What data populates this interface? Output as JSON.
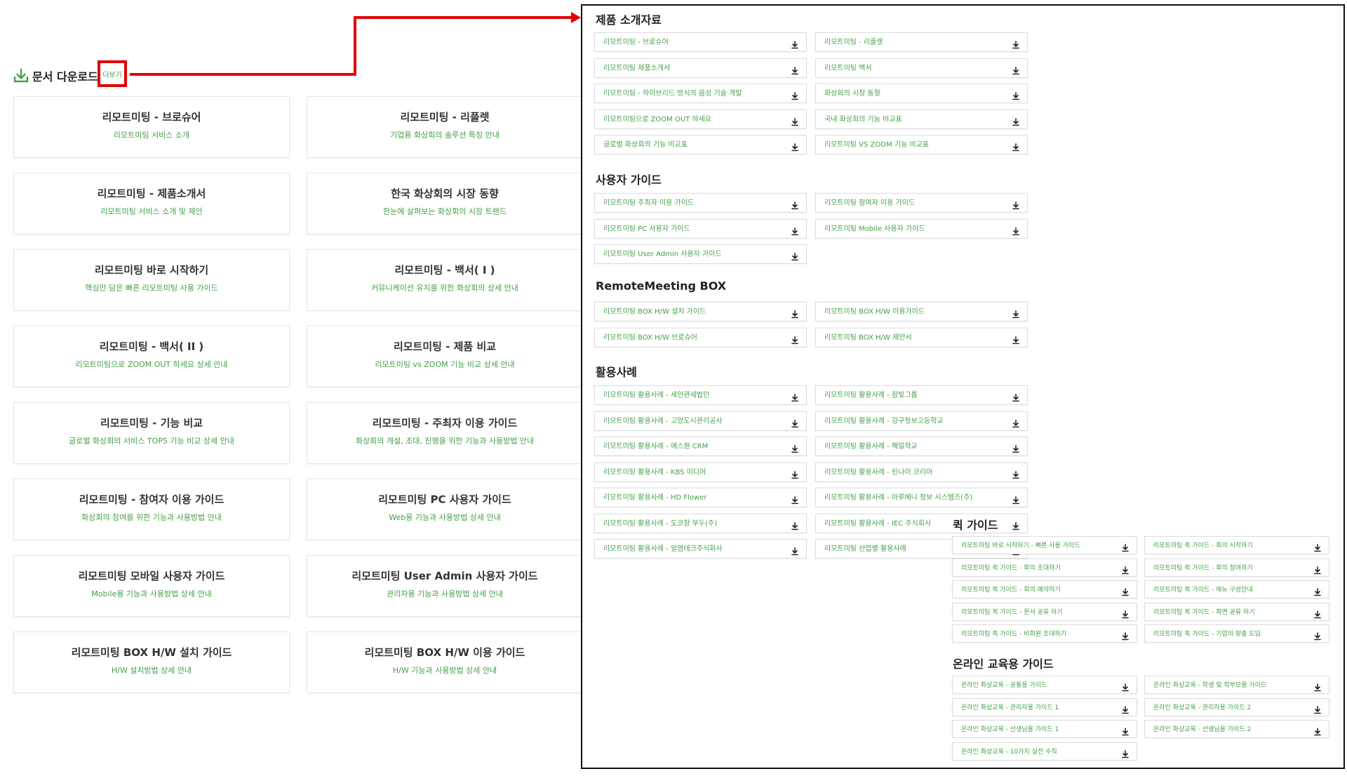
{
  "left": {
    "header_title": "문서 다운로드",
    "more_label": "더보기",
    "cards": [
      {
        "title": "리모트미팅 - 브로슈어",
        "sub": "리모트미팅 서비스 소개"
      },
      {
        "title": "리모트미팅 - 리플렛",
        "sub": "기업용 화상회의 솔루션 특징 안내"
      },
      {
        "title": "리모트미팅 - 제품소개서",
        "sub": "리모트미팅 서비스 소개 및 제안"
      },
      {
        "title": "한국 화상회의 시장 동향",
        "sub": "한눈에 살펴보는 화상회의 시장 트렌드"
      },
      {
        "title": "리모트미팅 바로 시작하기",
        "sub": "핵심만 담은 빠른 리모트미팅 사용 가이드"
      },
      {
        "title": "리모트미팅 - 백서( I )",
        "sub": "커뮤니케이션 유지를 위한 화상회의 상세 안내"
      },
      {
        "title": "리모트미팅 - 백서( II )",
        "sub": "리모트미팅으로 ZOOM OUT 하세요 상세 안내"
      },
      {
        "title": "리모트미팅 - 제품 비교",
        "sub": "리모트미팅 vs ZOOM 기능 비교 상세 안내"
      },
      {
        "title": "리모트미팅 - 기능 비교",
        "sub": "글로벌 화상회의 서비스 TOP5 기능 비교 상세 안내"
      },
      {
        "title": "리모트미팅 - 주최자 이용 가이드",
        "sub": "화상회의 개설, 초대, 진행을 위한 기능과 사용방법 안내"
      },
      {
        "title": "리모트미팅 - 참여자 이용 가이드",
        "sub": "화상회의 참여를 위한 기능과 사용방법 안내"
      },
      {
        "title": "리모트미팅 PC 사용자 가이드",
        "sub": "Web용 기능과 사용방법 상세 안내"
      },
      {
        "title": "리모트미팅 모바일 사용자 가이드",
        "sub": "Mobile용 기능과 사용방법 상세 안내"
      },
      {
        "title": "리모트미팅 User Admin 사용자 가이드",
        "sub": "관리자용 기능과 사용방법 상세 안내"
      },
      {
        "title": "리모트미팅 BOX H/W 설치 가이드",
        "sub": "H/W 설치방법 상세 안내"
      },
      {
        "title": "리모트미팅 BOX H/W 이용 가이드",
        "sub": "H/W 기능과 사용방법 상세 안내"
      }
    ]
  },
  "panel": {
    "sections": {
      "product": {
        "title": "제품 소개자료",
        "items": [
          "리모트미팅 - 브로슈어",
          "리모트미팅 - 리플렛",
          "리모트미팅 제품소개서",
          "리모트미팅 백서",
          "리모트미팅 - 하이브리드 방식의 음성 기술 개발",
          "화상회의 시장 동향",
          "리모트미팅으로 ZOOM OUT 하세요",
          "국내 화상회의 기능 비교표",
          "글로벌 화상회의 기능 비교표",
          "리모트미팅 VS ZOOM 기능 비교표"
        ]
      },
      "user_guide": {
        "title": "사용자 가이드",
        "items": [
          "리모트미팅 주최자 이용 가이드",
          "리모트미팅 참여자 이용 가이드",
          "리모트미팅 PC 사용자 가이드",
          "리모트미팅 Mobile 사용자 가이드",
          "리모트미팅 User Admin 사용자 가이드"
        ]
      },
      "box": {
        "title": "RemoteMeeting BOX",
        "items": [
          "리모트미팅 BOX H/W 설치 가이드",
          "리모트미팅 BOX H/W 이용가이드",
          "리모트미팅 BOX H/W 브로슈어",
          "리모트미팅 BOX H/W 제안서"
        ]
      },
      "cases": {
        "title": "활용사례",
        "items": [
          "리모트미팅 활용사례 - 세인관세법인",
          "리모트미팅 활용사례 - 참빛그룹",
          "리모트미팅 활용사례 - 고양도시관리공사",
          "리모트미팅 활용사례 - 강구정보고등학교",
          "리모트미팅 활용사례 - 에스원 CRM",
          "리모트미팅 활용사례 - 해밀학교",
          "리모트미팅 활용사례 - KBS 미디어",
          "리모트미팅 활용사례 - 린나이 코리아",
          "리모트미팅 활용사례 - HD Flower",
          "리모트미팅 활용사례 - 마루베니 정보 시스템즈(주)",
          "리모트미팅 활용사례 - 도코항 부두(주)",
          "리모트미팅 활용사례 - IEC 주식회사",
          "리모트미팅 활용사례 - 알엠테크주식회사",
          "리모트미팅 산업별 활용사례"
        ]
      },
      "quick": {
        "title": "퀵 가이드",
        "items": [
          "리모트미팅 바로 시작하기 - 빠른 사용 가이드",
          "리모트미팅 퀵 가이드 - 회의 시작하기",
          "리모트미팅 퀵 가이드 - 회의 초대하기",
          "리모트미팅 퀵 가이드 - 회의 참여하기",
          "리모트미팅 퀵 가이드 - 회의 예약하기",
          "리모트미팅 퀵 가이드 - 메뉴 구성안내",
          "리모트미팅 퀵 가이드 - 문서 공유 하기",
          "리모트미팅 퀵 가이드 - 화면 공유 하기",
          "리모트미팅 퀵 가이드 - 비회원 초대하기",
          "리모트미팅 퀵 가이드 - 기업의 맞춤 도입"
        ]
      },
      "edu": {
        "title": "온라인 교육용 가이드",
        "items": [
          "온라인 화상교육 - 공통용 가이드",
          "온라인 화상교육 - 학생 및 학부모용 가이드",
          "온라인 화상교육 - 관리자용 가이드 1",
          "온라인 화상교육 - 관리자용 가이드 2",
          "온라인 화상교육 - 선생님용 가이드 1",
          "온라인 화상교육 - 선생님용 가이드 2",
          "온라인 화상교육 - 10가지 실전 수칙"
        ]
      }
    }
  },
  "colors": {
    "accent": "#43a047",
    "highlight": "#e00000"
  }
}
